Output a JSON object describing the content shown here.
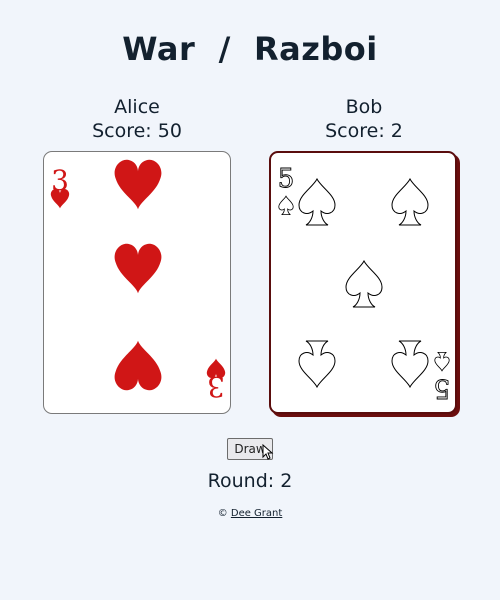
{
  "title": "War  /  Razboi",
  "players": [
    {
      "name": "Alice",
      "score_text": "Score: 50",
      "card": {
        "rank": "3",
        "suit": "hearts",
        "suit_color": "#d01616",
        "back_color": "#ffffff"
      }
    },
    {
      "name": "Bob",
      "score_text": "Score: 2",
      "card": {
        "rank": "5",
        "suit": "spades",
        "suit_color": "#ffffff",
        "outline_color": "#000000",
        "border_color": "#5a0d0d"
      }
    }
  ],
  "draw_button": {
    "label": "Draw"
  },
  "round_text": "Round: 2",
  "credit": {
    "symbol": "©",
    "author": "Dee Grant"
  },
  "icons": {
    "heart": "heart-icon",
    "spade": "spade-icon",
    "cursor": "mouse-cursor-icon"
  }
}
